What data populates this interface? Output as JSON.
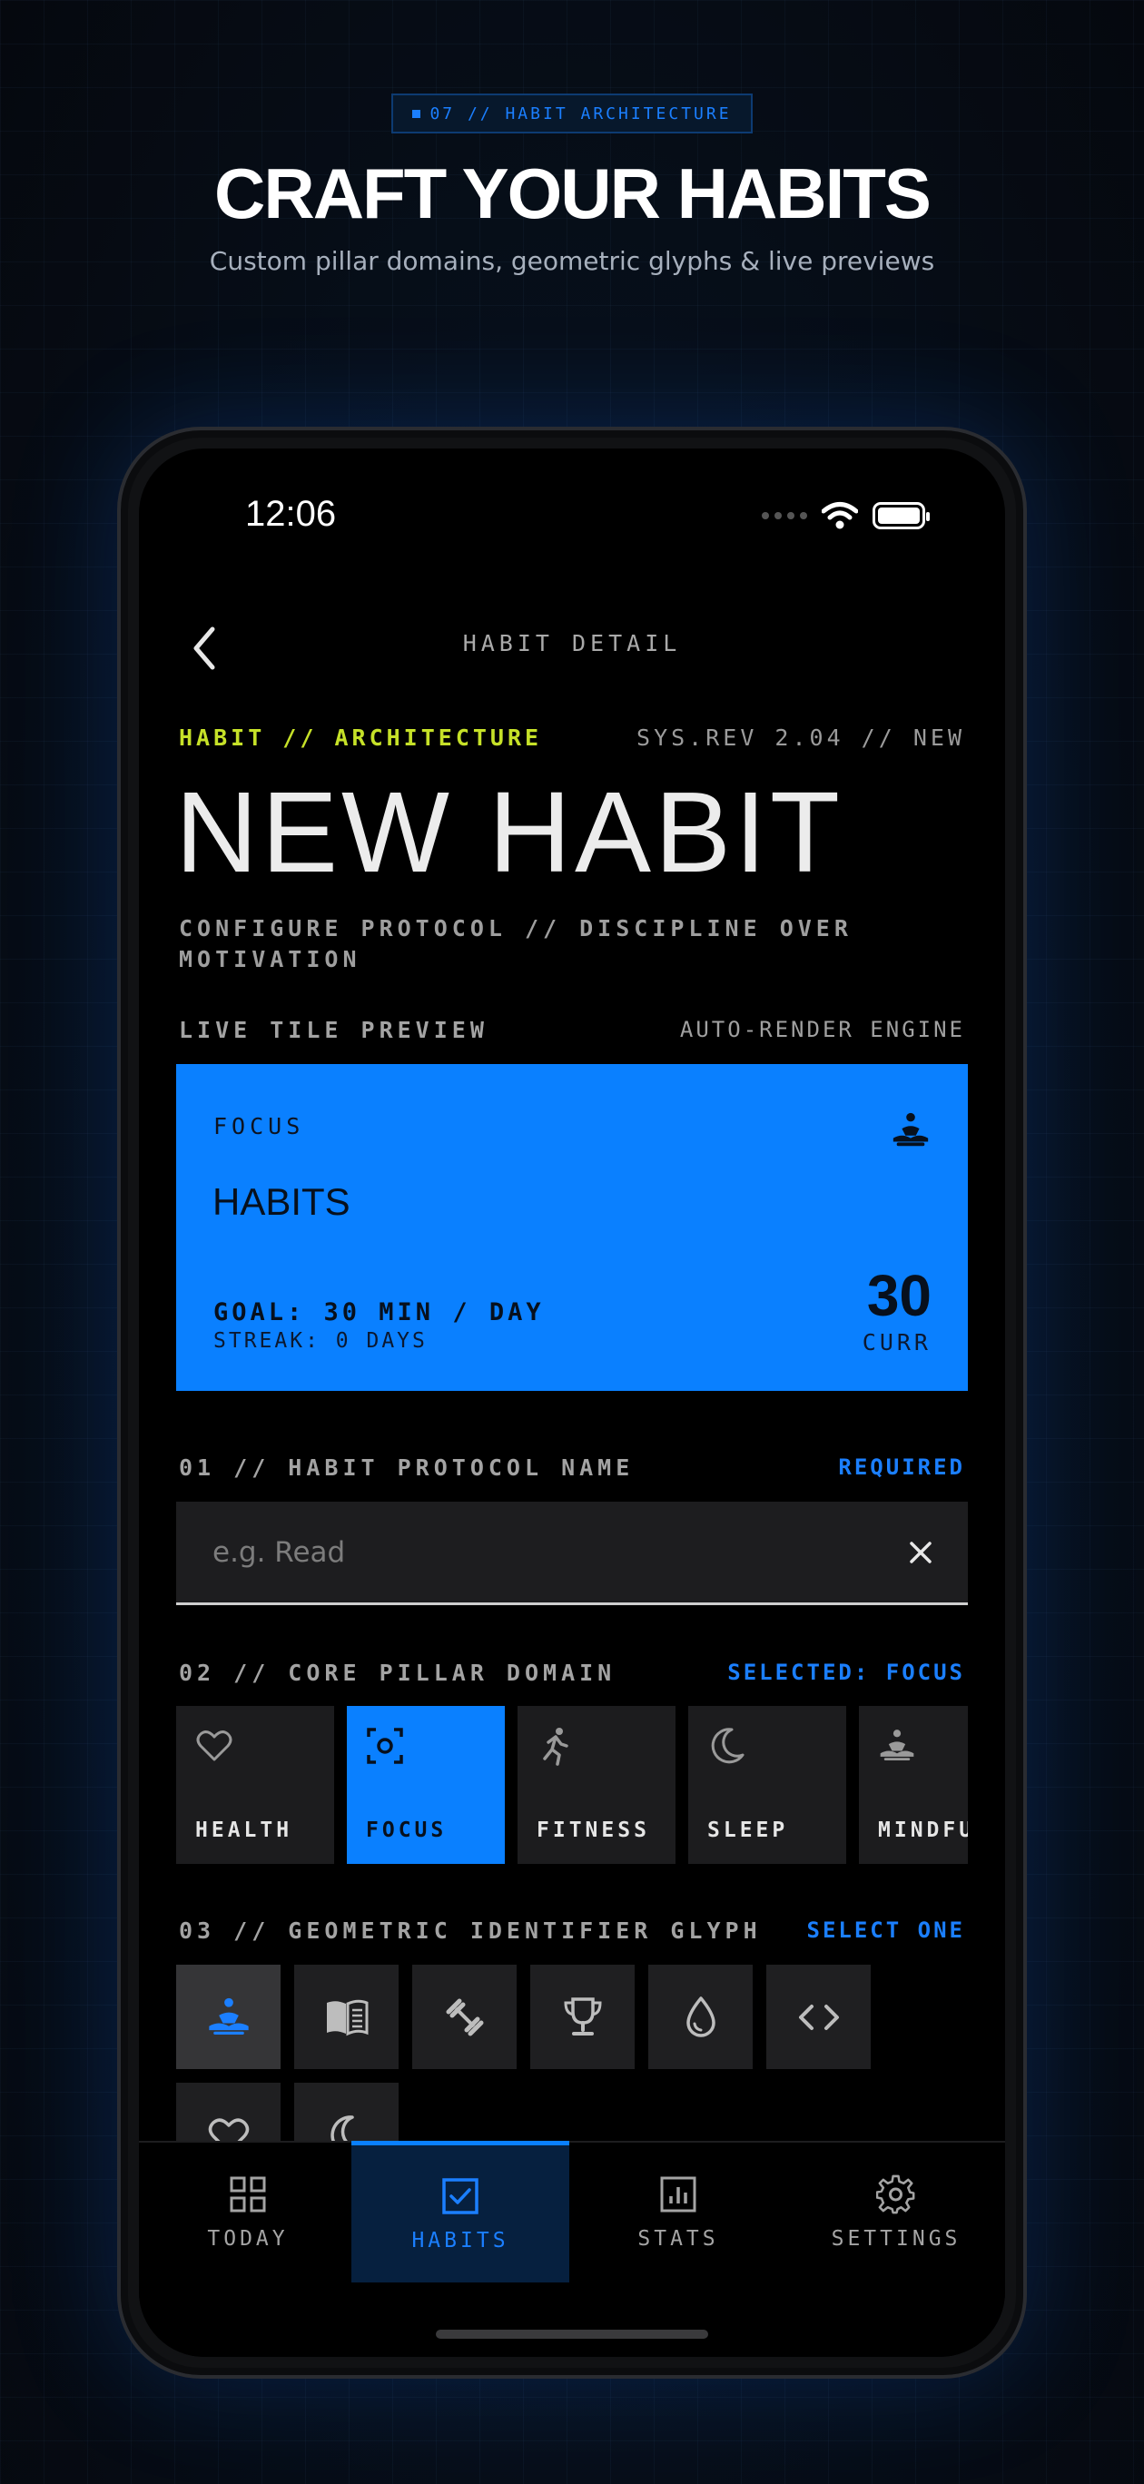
{
  "marketing": {
    "eyebrow": "07 // HABIT ARCHITECTURE",
    "title": "CRAFT YOUR HABITS",
    "subtitle": "Custom pillar domains, geometric glyphs & live previews"
  },
  "status_bar": {
    "time": "12:06"
  },
  "nav": {
    "title": "HABIT DETAIL"
  },
  "header": {
    "kicker_left": "HABIT // ARCHITECTURE",
    "kicker_right": "SYS.REV 2.04 // NEW",
    "title": "NEW HABIT",
    "subtitle": "CONFIGURE PROTOCOL // DISCIPLINE OVER MOTIVATION"
  },
  "preview": {
    "label": "LIVE TILE PREVIEW",
    "right_label": "AUTO-RENDER ENGINE",
    "tile": {
      "category": "FOCUS",
      "name": "HABITS",
      "goal": "GOAL: 30 MIN / DAY",
      "streak": "STREAK: 0 DAYS",
      "value": "30",
      "unit": "CURR",
      "color": "#0A80FF",
      "icon": "meditation-icon"
    }
  },
  "name_section": {
    "label": "01 // HABIT PROTOCOL NAME",
    "right_label": "REQUIRED",
    "placeholder": "e.g. Read",
    "value": ""
  },
  "pillar_section": {
    "label": "02 // CORE PILLAR DOMAIN",
    "right_label": "SELECTED: FOCUS",
    "items": [
      {
        "label": "HEALTH",
        "icon": "heart-icon",
        "selected": false
      },
      {
        "label": "FOCUS",
        "icon": "focus-icon",
        "selected": true
      },
      {
        "label": "FITNESS",
        "icon": "running-icon",
        "selected": false
      },
      {
        "label": "SLEEP",
        "icon": "moon-icon",
        "selected": false
      },
      {
        "label": "MINDFU",
        "icon": "meditation-icon",
        "selected": false
      }
    ]
  },
  "glyph_section": {
    "label": "03 // GEOMETRIC IDENTIFIER GLYPH",
    "right_label": "SELECT ONE",
    "items": [
      {
        "icon": "meditation-icon",
        "selected": true
      },
      {
        "icon": "book-icon",
        "selected": false
      },
      {
        "icon": "dumbbell-icon",
        "selected": false
      },
      {
        "icon": "trophy-icon",
        "selected": false
      },
      {
        "icon": "water-drop-icon",
        "selected": false
      },
      {
        "icon": "code-icon",
        "selected": false
      },
      {
        "icon": "heart-icon",
        "selected": false
      },
      {
        "icon": "moon-icon",
        "selected": false
      }
    ]
  },
  "tabbar": {
    "items": [
      {
        "label": "TODAY",
        "icon": "grid-icon",
        "active": false
      },
      {
        "label": "HABITS",
        "icon": "checkbox-icon",
        "active": true
      },
      {
        "label": "STATS",
        "icon": "bar-chart-icon",
        "active": false
      },
      {
        "label": "SETTINGS",
        "icon": "gear-icon",
        "active": false
      }
    ]
  },
  "colors": {
    "accent": "#0A80FF",
    "kicker": "#C6E128",
    "background": "#000000"
  }
}
